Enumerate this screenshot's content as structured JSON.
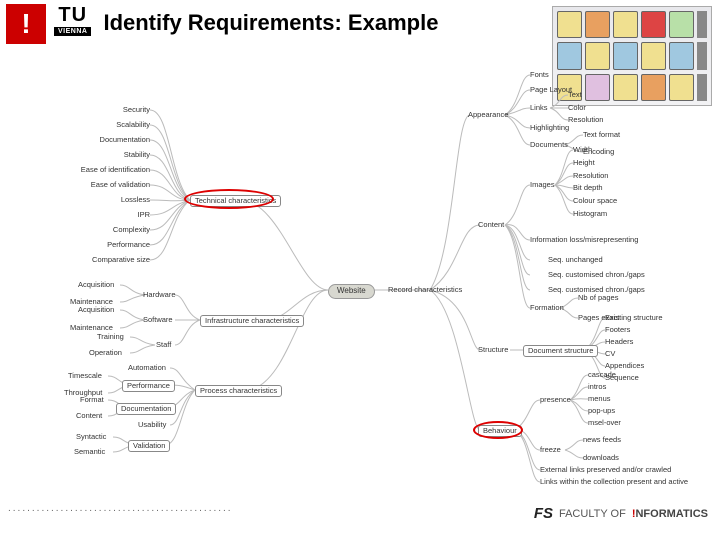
{
  "header": {
    "excl": "!",
    "tu_top": "TU",
    "tu_bot": "VIENNA",
    "title": "Identify Requirements: Example"
  },
  "mindmap": {
    "center": "Website",
    "left_branches": {
      "technical": {
        "label": "Technical characteristics",
        "items": [
          "Security",
          "Scalability",
          "Documentation",
          "Stability",
          "Ease of identification",
          "Ease of validation",
          "Lossless",
          "IPR",
          "Complexity",
          "Performance",
          "Comparative size"
        ]
      },
      "infrastructure": {
        "label": "Infrastructure characteristics",
        "hardware": {
          "label": "Hardware",
          "items": [
            "Acquisition",
            "Maintenance"
          ]
        },
        "software": {
          "label": "Software",
          "items": [
            "Acquisition",
            "Maintenance"
          ]
        },
        "staff": {
          "label": "Staff",
          "items": [
            "Training",
            "Operation"
          ]
        }
      },
      "process": {
        "label": "Process characteristics",
        "automation": "Automation",
        "performance": {
          "label": "Performance",
          "items": [
            "Timescale",
            "Throughput"
          ]
        },
        "documentation": {
          "label": "Documentation",
          "items": [
            "Format",
            "Content"
          ]
        },
        "usability": "Usability",
        "validation": {
          "label": "Validation",
          "items": [
            "Syntactic",
            "Semantic"
          ]
        }
      }
    },
    "right_branches": {
      "record": {
        "label": "Record characteristics",
        "appearance": {
          "label": "Appearance",
          "fonts": "Fonts",
          "page_layout": "Page Layout",
          "links": {
            "label": "Links",
            "items": [
              "Text",
              "Color",
              "Resolution"
            ]
          },
          "highlighting": "Highlighting",
          "documents": {
            "label": "Documents",
            "items": [
              "Text format",
              "Encoding"
            ]
          }
        },
        "content": {
          "label": "Content",
          "images": {
            "label": "Images",
            "items": [
              "Width",
              "Height",
              "Resolution",
              "Bit depth",
              "Colour space",
              "Histogram"
            ]
          },
          "info_loss": "Information loss/misrepresenting",
          "sequence": [
            "Seq. unchanged",
            "Seq. customised chron./gaps",
            "Seq. customised chron./gaps"
          ],
          "formation": {
            "label": "Formation",
            "items": [
              "Nb of pages",
              "Pages exact"
            ]
          }
        },
        "structure": {
          "label": "Structure",
          "doc": {
            "label": "Document structure",
            "items": [
              "Existing structure",
              "Footers",
              "Headers",
              "CV",
              "Appendices",
              "Sequence"
            ]
          }
        },
        "behaviour": {
          "label": "Behaviour",
          "presence": {
            "label": "presence",
            "items": [
              "cascade",
              "intros",
              "menus",
              "pop-ups",
              "msel-over"
            ]
          },
          "freeze": {
            "label": "freeze",
            "items": [
              "news feeds",
              "downloads"
            ]
          },
          "external": "External links preserved and/or crawled",
          "links_within": "Links within the collection present and active"
        }
      }
    }
  },
  "circles": {
    "tech_char": true,
    "behaviour": true
  },
  "footer": {
    "dots": "...............................................",
    "fs": "FS",
    "faculty": "FACULTY OF",
    "informatics_pre": "!",
    "informatics": "NFORMATICS"
  }
}
